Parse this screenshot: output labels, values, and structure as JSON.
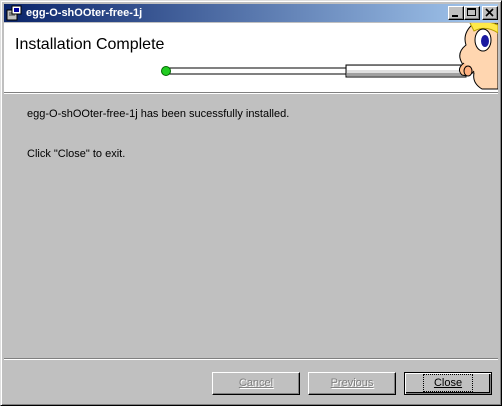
{
  "window": {
    "title": "egg-O-shOOter-free-1j"
  },
  "banner": {
    "heading": "Installation Complete"
  },
  "messages": {
    "installed": "egg-O-shOOter-free-1j has been sucessfully installed.",
    "exit_hint": "Click \"Close\" to exit."
  },
  "buttons": {
    "cancel": "Cancel",
    "previous": "Previous",
    "close": "Close"
  },
  "progress": {
    "value": 1.0
  },
  "colors": {
    "titlebar_start": "#0a246a",
    "titlebar_end": "#a6caf0",
    "face_gray": "#c0c0c0",
    "progress_dot": "#22cc22"
  }
}
